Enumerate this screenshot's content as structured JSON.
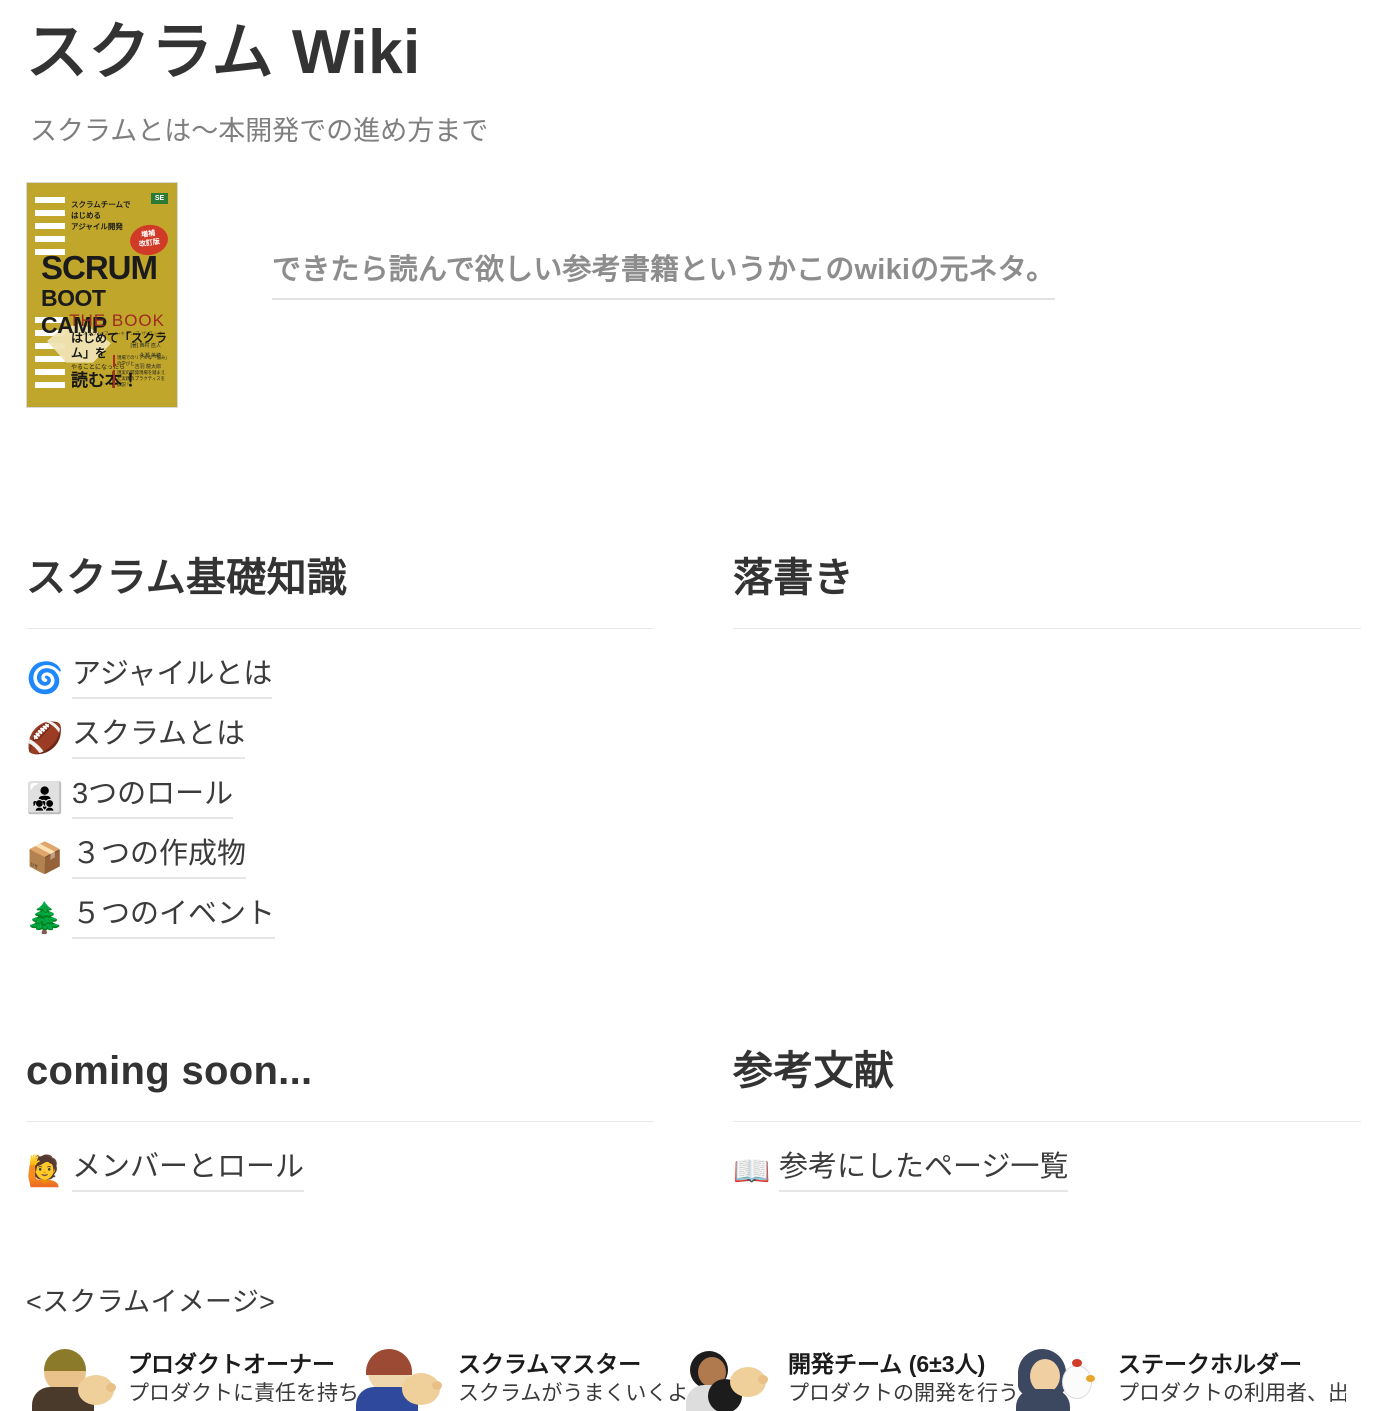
{
  "header": {
    "title": "スクラム Wiki",
    "subtitle": "スクラムとは〜本開発での進め方まで"
  },
  "book": {
    "caption": "できたら読んで欲しい参考書籍というかこのwikiの元ネタ。",
    "cover": {
      "publisher": "SE",
      "top_lines": "スクラムチームで\nはじめる\nアジャイル開発",
      "badge": "増補\n改訂版",
      "title_main": "SCRUM",
      "title_sub": "BOOT CAMP",
      "title_the_book": "THE BOOK",
      "romaji": "スクラム・ブート・キャンプ ザ・ブック",
      "authors": "[著] 西村 直人\n永瀬 美穂\n吉羽 龍太郎",
      "bottom_line1": "はじめて「スクラム」を",
      "bottom_line2": "やることになったら",
      "bottom_line3": "読む本！",
      "bullets": [
        "現場でのリアルな「悩み」の学びと",
        "現実の開発現場を踏まえた実践のプラクティスを詳説！"
      ]
    }
  },
  "sections": [
    {
      "id": "scrum-basics",
      "title": "スクラム基礎知識",
      "items": [
        {
          "emoji": "🌀",
          "icon_name": "spiral-icon",
          "label": "アジャイルとは"
        },
        {
          "emoji": "🏈",
          "icon_name": "football-icon",
          "label": "スクラムとは"
        },
        {
          "emoji": "👨‍👧‍👦",
          "icon_name": "family-icon",
          "label": "3つのロール"
        },
        {
          "emoji": "📦",
          "icon_name": "package-icon",
          "label": "３つの作成物"
        },
        {
          "emoji": "🌲",
          "icon_name": "evergreen-tree-icon",
          "label": "５つのイベント"
        }
      ]
    },
    {
      "id": "scribbles",
      "title": "落書き",
      "items": []
    },
    {
      "id": "coming-soon",
      "title": "coming soon...",
      "items": [
        {
          "emoji": "🙋",
          "icon_name": "raising-hand-icon",
          "label": "メンバーとロール"
        }
      ]
    },
    {
      "id": "references",
      "title": "参考文献",
      "items": [
        {
          "emoji": "📖",
          "icon_name": "open-book-icon",
          "label": "参考にしたページ一覧"
        }
      ]
    }
  ],
  "scrum_image": {
    "label": "<スクラムイメージ>",
    "personas": [
      {
        "name": "プロダクトオーナー",
        "desc": "プロダクトに責任を持ち、",
        "head": "#e8c28a",
        "hair": "#8a7a2a",
        "body": "#4a3a2c"
      },
      {
        "name": "スクラムマスター",
        "desc": "スクラムがうまくいくよう",
        "head": "#f0d6ad",
        "hair": "#9c4a33",
        "body": "#2f4a9c"
      },
      {
        "name": "開発チーム (6±3人)",
        "desc": "プロダクトの開発を行う。",
        "head": "#b07a4e",
        "hair": "#1c1c1c",
        "body": "#2a2a2a"
      },
      {
        "name": "ステークホルダー",
        "desc": "プロダクトの利用者、出資者、",
        "head": "#f0cfa2",
        "hair": "#3c4760",
        "body": "#3c4760"
      }
    ]
  },
  "colors": {
    "text": "#333333",
    "muted": "#8d8d8d",
    "rule": "#e9e9e9",
    "link_underline": "#e6e6e6",
    "book_gold": "#c0a62b"
  }
}
